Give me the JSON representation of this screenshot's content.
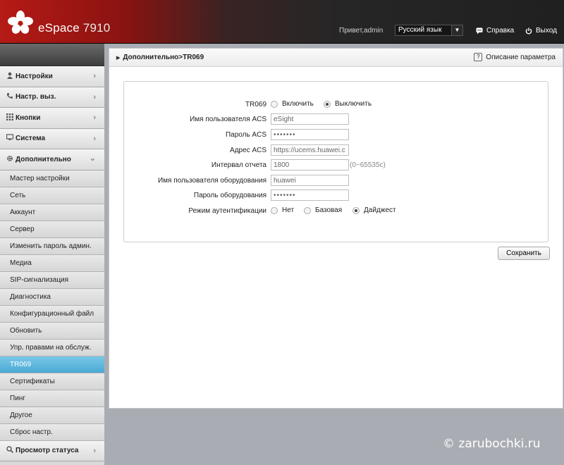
{
  "header": {
    "brand": "eSpace",
    "model": "7910",
    "greeting": "Привет,admin",
    "language": "Русский язык",
    "help_label": "Справка",
    "logout_label": "Выход",
    "accent": "#b51a16"
  },
  "sidebar": {
    "sections": [
      {
        "label": "Настройки",
        "icon": "user-icon"
      },
      {
        "label": "Настр. выз.",
        "icon": "phone-icon"
      },
      {
        "label": "Кнопки",
        "icon": "keypad-icon"
      },
      {
        "label": "Система",
        "icon": "monitor-icon"
      },
      {
        "label": "Дополнительно",
        "icon": "gear-icon"
      }
    ],
    "advanced_items": [
      "Мастер настройки",
      "Сеть",
      "Аккаунт",
      "Сервер",
      "Изменить пароль админ.",
      "Медиа",
      "SIP-сигнализация",
      "Диагностика",
      "Конфигурационный файл",
      "Обновить",
      "Упр. правами на обслуж.",
      "TR069",
      "Сертификаты",
      "Пинг",
      "Другое",
      "Сброс настр."
    ],
    "active_item": "TR069",
    "status_section": "Просмотр статуса"
  },
  "main": {
    "breadcrumb": "Дополнительно>TR069",
    "param_desc": "Описание параметра",
    "form": {
      "tr069_label": "TR069",
      "enable_label": "Включить",
      "disable_label": "Выключить",
      "tr069_value": "Выключить",
      "acs_user_label": "Имя пользователя ACS",
      "acs_user_value": "eSight",
      "acs_pass_label": "Пароль ACS",
      "acs_pass_value": "•••••••",
      "acs_addr_label": "Адрес ACS",
      "acs_addr_value": "https://ucems.huawei.c",
      "interval_label": "Интервал отчета",
      "interval_value": "1800",
      "interval_hint": "(0~65535с)",
      "dev_user_label": "Имя пользователя оборудования",
      "dev_user_value": "huawei",
      "dev_pass_label": "Пароль оборудования",
      "dev_pass_value": "•••••••",
      "auth_label": "Режим аутентификации",
      "auth_none": "Нет",
      "auth_basic": "Базовая",
      "auth_digest": "Дайджест",
      "auth_value": "Дайджест"
    },
    "save_label": "Сохранить"
  },
  "watermark": "© zarubochki.ru"
}
